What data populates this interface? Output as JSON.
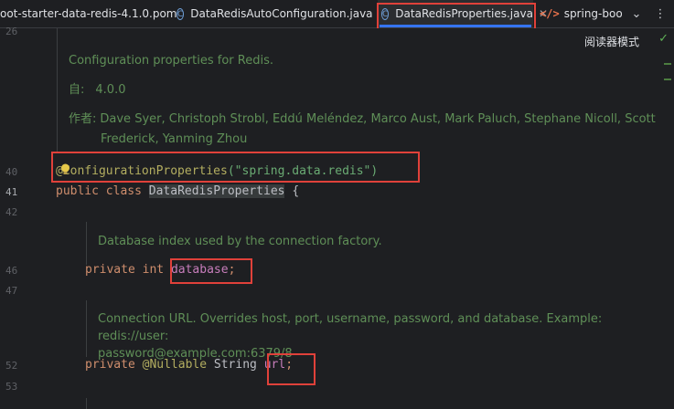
{
  "tabs": [
    {
      "label": "oot-starter-data-redis-4.1.0.pom",
      "icon": "maven-file-icon"
    },
    {
      "label": "DataRedisAutoConfiguration.java",
      "icon": "java-class-icon"
    },
    {
      "label": "DataRedisProperties.java",
      "icon": "java-class-icon",
      "active": true
    },
    {
      "label": "spring-boot",
      "icon": "xml-file-icon"
    }
  ],
  "tab_overflow": "⌄",
  "tab_more": "⋮",
  "reader_mode": "阅读器模式",
  "line_numbers": {
    "l26": "26",
    "l40": "40",
    "l41": "41",
    "l42": "42",
    "l46": "46",
    "l47": "47",
    "l52": "52",
    "l53": "53"
  },
  "class_doc": {
    "summary": "Configuration properties for Redis.",
    "since_key": "自:",
    "since_value": "4.0.0",
    "author_key": "作者:",
    "authors_line1": "Dave Syer, Christoph Strobl, Eddú Meléndez, Marco Aust, Mark Paluch, Stephane Nicoll, Scott",
    "authors_line2": "Frederick, Yanming Zhou"
  },
  "code": {
    "annotation": "@ConfigurationProperties",
    "annotation_arg": "(\"spring.data.redis\")",
    "public_kw": "public",
    "class_kw": "class",
    "class_name": "DataRedisProperties",
    "brace": "{",
    "database_doc": "Database index used by the connection factory.",
    "private_kw": "private",
    "int_kw": "int",
    "database_field": "database",
    "semicolon": ";",
    "url_doc_line1": "Connection URL. Overrides host, port, username, password, and database. Example: redis://user:",
    "url_doc_line2": "password@example.com:6379/8",
    "nullable_ann": "@Nullable",
    "string_type": "String",
    "url_field": "url"
  }
}
